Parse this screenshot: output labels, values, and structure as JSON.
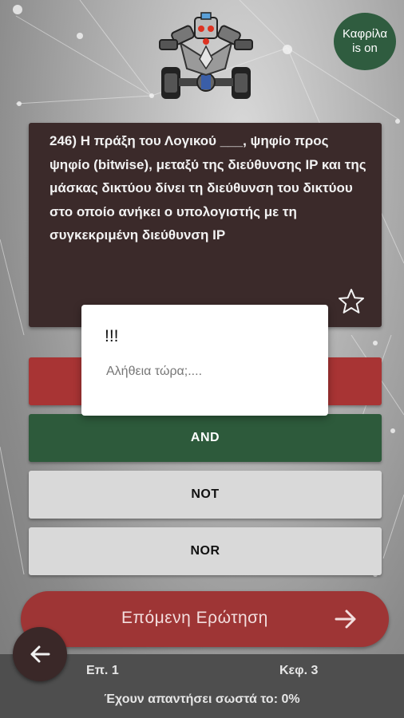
{
  "badge": {
    "text_line1": "Καφρίλα",
    "text_line2": "is on",
    "color": "#2f5c3f"
  },
  "logo": {
    "name": "robot-car-logo"
  },
  "question": {
    "number": "246)",
    "text": "Η πράξη του Λογικού ___, ψηφίο προς ψηφίο (bitwise), μεταξύ της διεύθυνσης IP και της μάσκας δικτύου δίνει τη διεύθυνση του δικτύου στο οποίο ανήκει ο υπολογιστής με τη συγκεκριμένη διεύθυνση IP",
    "favorite_icon": "star-outline-icon"
  },
  "options": [
    {
      "label": "",
      "state": "wrong",
      "color": "#a83434"
    },
    {
      "label": "AND",
      "state": "correct",
      "color": "#2d5a3b"
    },
    {
      "label": "NOT",
      "state": "neutral",
      "color": "#d9d9d9"
    },
    {
      "label": "NOR",
      "state": "neutral",
      "color": "#d9d9d9"
    }
  ],
  "next_button": {
    "label": "Επόμενη Ερώτηση",
    "icon": "arrow-right-icon",
    "color": "#9e3535"
  },
  "back_button": {
    "icon": "arrow-left-icon"
  },
  "footer": {
    "episode": "Επ. 1",
    "chapter": "Κεφ. 3",
    "stats": "Έχουν απαντήσει σωστά το: 0%"
  },
  "dialog": {
    "title": "!!!",
    "message": "Αλήθεια τώρα;...."
  }
}
